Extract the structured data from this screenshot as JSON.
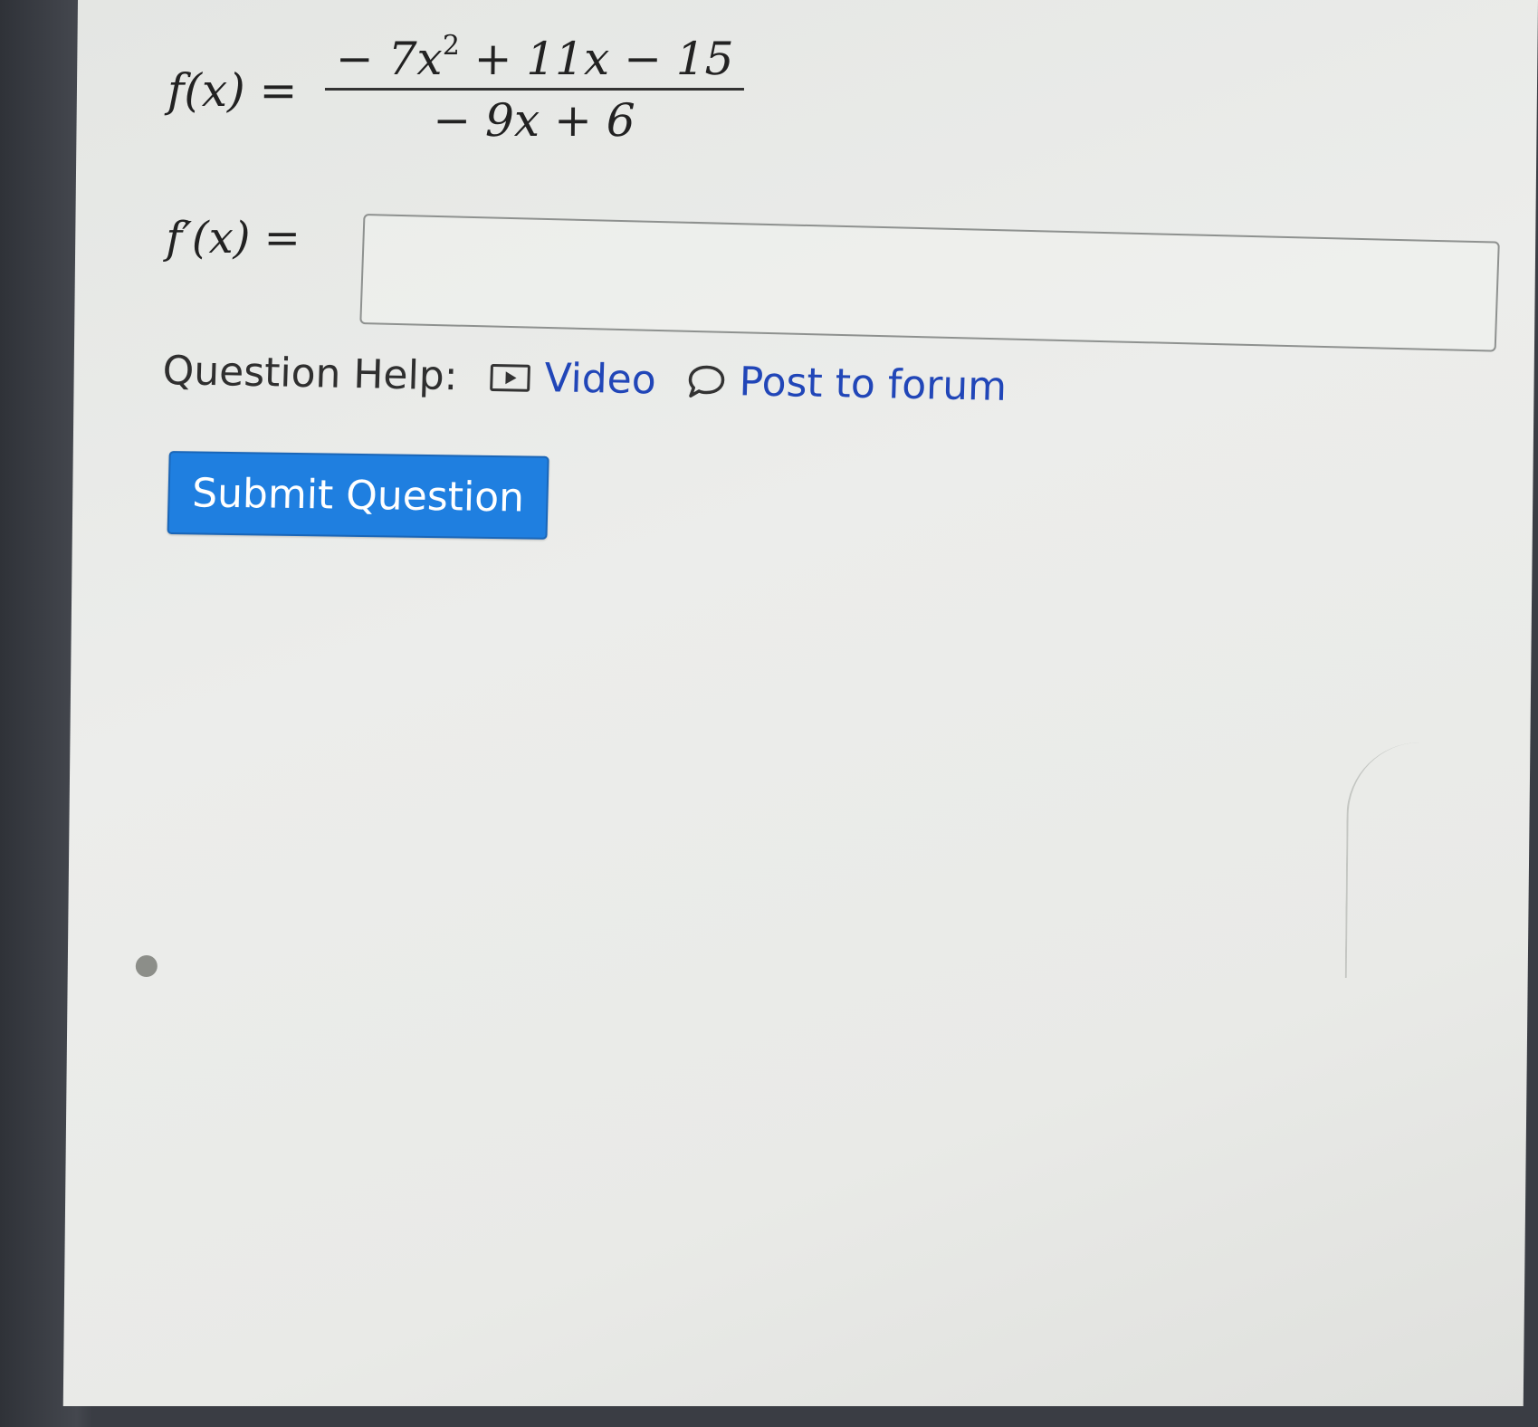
{
  "question": {
    "function_label": "f(x) =",
    "numerator": {
      "lead": "− 7x",
      "exponent": "2",
      "rest": " + 11x − 15"
    },
    "denominator": "− 9x + 6",
    "derivative_label": "f′(x) =",
    "answer_value": ""
  },
  "help": {
    "label": "Question Help:",
    "video_icon": "play-icon",
    "video_label": "Video",
    "forum_icon": "chat-bubble-icon",
    "forum_label": "Post to forum"
  },
  "actions": {
    "submit_label": "Submit Question"
  },
  "colors": {
    "link": "#2146b8",
    "submit_bg": "#1f7fe0",
    "submit_text": "#ffffff"
  }
}
